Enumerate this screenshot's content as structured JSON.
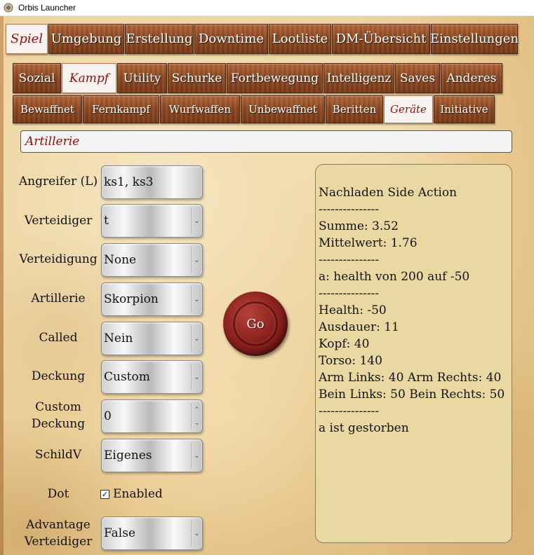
{
  "window": {
    "title": "Orbis Launcher"
  },
  "tabs_main": [
    {
      "label": "Spiel",
      "active": true
    },
    {
      "label": "Umgebung",
      "active": false
    },
    {
      "label": "Erstellung",
      "active": false
    },
    {
      "label": "Downtime",
      "active": false
    },
    {
      "label": "Lootliste",
      "active": false
    },
    {
      "label": "DM-Übersicht",
      "active": false
    },
    {
      "label": "Einstellungen",
      "active": false
    }
  ],
  "tabs_category": [
    {
      "label": "Sozial",
      "active": false
    },
    {
      "label": "Kampf",
      "active": true
    },
    {
      "label": "Utility",
      "active": false
    },
    {
      "label": "Schurke",
      "active": false
    },
    {
      "label": "Fortbewegung",
      "active": false
    },
    {
      "label": "Intelligenz",
      "active": false
    },
    {
      "label": "Saves",
      "active": false
    },
    {
      "label": "Anderes",
      "active": false
    }
  ],
  "tabs_sub": [
    {
      "label": "Bewaffnet",
      "active": false
    },
    {
      "label": "Fernkampf",
      "active": false
    },
    {
      "label": "Wurfwaffen",
      "active": false
    },
    {
      "label": "Unbewaffnet",
      "active": false
    },
    {
      "label": "Beritten",
      "active": false
    },
    {
      "label": "Geräte",
      "active": true
    },
    {
      "label": "Initiative",
      "active": false
    }
  ],
  "section": {
    "title": "Artillerie"
  },
  "form": {
    "angreifer": {
      "label": "Angreifer (L)",
      "value": "ks1, ks3"
    },
    "verteidiger": {
      "label": "Verteidiger",
      "value": "t"
    },
    "verteidigung": {
      "label": "Verteidigung",
      "value": "None"
    },
    "artillerie": {
      "label": "Artillerie",
      "value": "Skorpion"
    },
    "called": {
      "label": "Called",
      "value": "Nein"
    },
    "deckung": {
      "label": "Deckung",
      "value": "Custom"
    },
    "custom_deckung": {
      "label_line1": "Custom",
      "label_line2": "Deckung",
      "value": "0"
    },
    "schildv": {
      "label": "SchildV",
      "value": "Eigenes"
    },
    "dot": {
      "label": "Dot",
      "checkbox_label": "Enabled",
      "checked": true,
      "check_glyph": "✓"
    },
    "advantage": {
      "label_line1": "Advantage",
      "label_line2": "Verteidiger",
      "value": "False"
    }
  },
  "go_button": {
    "label": "Go"
  },
  "result_lines": [
    "Nachladen Side Action",
    "---------------",
    "Summe: 3.52",
    "Mittelwert: 1.76",
    "---------------",
    "a: health von 200 auf -50",
    "---------------",
    "Health: -50",
    "Ausdauer: 11",
    "Kopf: 40",
    "Torso: 140",
    "Arm Links: 40 Arm Rechts: 40",
    "Bein Links: 50 Bein Rechts: 50",
    "---------------",
    "a ist gestorben"
  ],
  "colors": {
    "tab_wood": "#8f4a22",
    "active_tab_text": "#8b1010",
    "result_panel_bg": "#e9d8a2",
    "seal_red": "#8e2320"
  }
}
